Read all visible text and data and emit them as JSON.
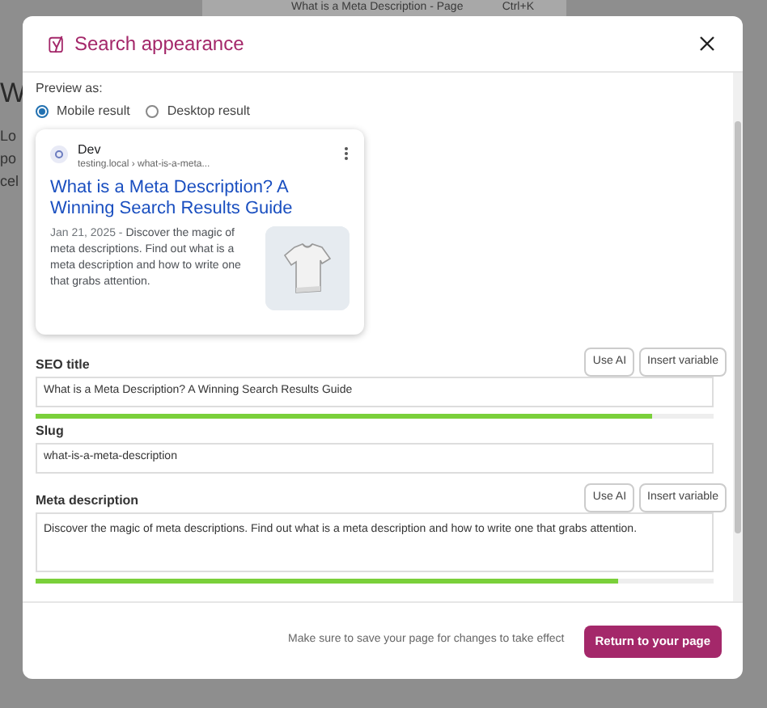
{
  "background": {
    "document_bar": {
      "title": "What is a Meta Description - Page",
      "shortcut": "Ctrl+K"
    },
    "heading": "W",
    "text_lines": [
      "Lo",
      "po",
      "cel"
    ]
  },
  "modal": {
    "title": "Search appearance",
    "preview": {
      "label": "Preview as:",
      "options": [
        {
          "label": "Mobile result",
          "selected": true
        },
        {
          "label": "Desktop result",
          "selected": false
        }
      ],
      "card": {
        "site": "Dev",
        "url": "testing.local › what-is-a-meta...",
        "title": "What is a Meta Description? A Winning Search Results Guide",
        "date": "Jan 21, 2025",
        "separator": "-",
        "description": "Discover the magic of meta descriptions. Find out what is a meta description and how to write one that grabs attention."
      }
    },
    "fields": [
      {
        "kind": "input",
        "label": "SEO title",
        "buttons": [
          "Use AI",
          "Insert variable"
        ],
        "value": "What is a Meta Description? A Winning Search Results Guide",
        "level": 0.91
      },
      {
        "kind": "input",
        "label": "Slug",
        "value": "what-is-a-meta-description"
      },
      {
        "kind": "textarea",
        "label": "Meta description",
        "buttons": [
          "Use AI",
          "Insert variable"
        ],
        "value": "Discover the magic of meta descriptions. Find out what is a meta description and how to write one that grabs attention.",
        "level": 0.86
      }
    ],
    "footer": {
      "note": "Make sure to save your page for changes to take effect",
      "button": "Return to your page"
    }
  }
}
